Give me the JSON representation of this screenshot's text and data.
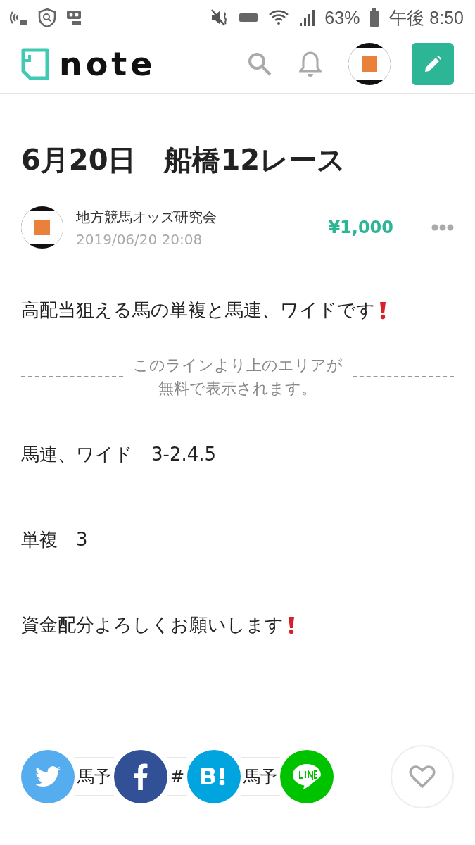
{
  "status_bar": {
    "battery": "63%",
    "time": "午後 8:50"
  },
  "header": {
    "logo": "note"
  },
  "article": {
    "title": "6月20日　船橋12レース",
    "author": {
      "name": "地方競馬オッズ研究会",
      "date": "2019/06/20 20:08"
    },
    "price": "¥1,000",
    "intro": "高配当狙える馬の単複と馬連、ワイドです",
    "paywall_notice": [
      "このラインより上のエリアが",
      "無料で表示されます。"
    ],
    "paragraphs": [
      {
        "text": "馬連、ワイド　3-2.4.5",
        "alert": false
      },
      {
        "text": "単複　3",
        "alert": false
      },
      {
        "text": "資金配分よろしくお願いします",
        "alert": true
      }
    ],
    "intro_alert": true
  },
  "tags": [
    {
      "segments": [
        "馬予"
      ]
    },
    {
      "segments": [
        "#",
        "馬予"
      ]
    }
  ],
  "share": [
    {
      "kind": "twitter",
      "color": "#55acee"
    },
    {
      "kind": "facebook",
      "color": "#315096"
    },
    {
      "kind": "hatena",
      "color": "#00a4de"
    },
    {
      "kind": "line",
      "color": "#00c300"
    }
  ],
  "like": {
    "liked": false
  }
}
